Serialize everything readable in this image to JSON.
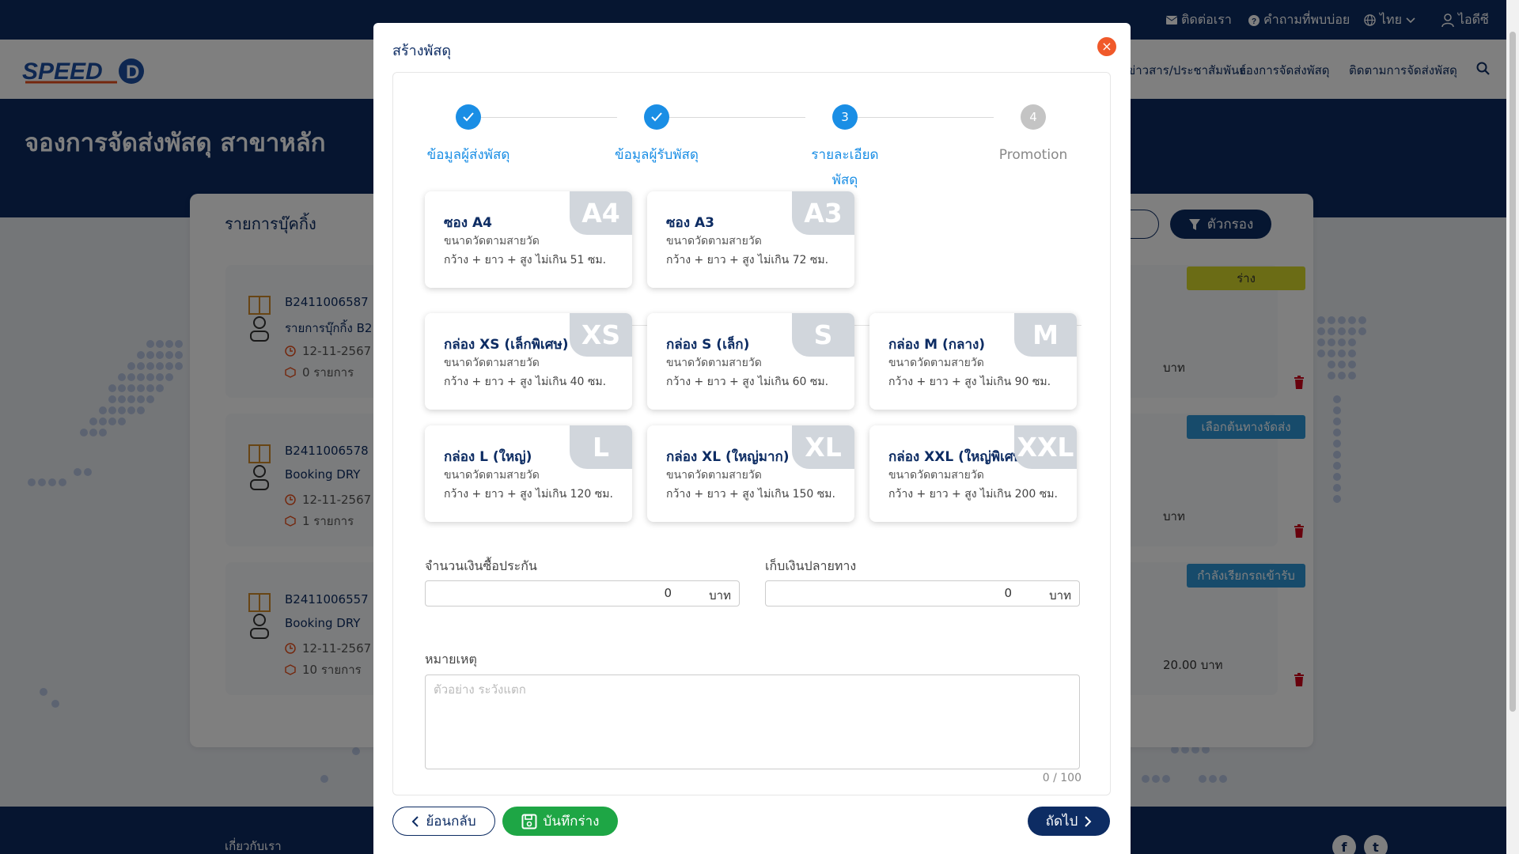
{
  "topbar": {
    "contact": "ติดต่อเรา",
    "faq": "คำถามที่พบบ่อย",
    "language": "ไทย",
    "account": "ไอดีซี"
  },
  "navbar": {
    "links": [
      "ข่าวสาร/ประชาสัมพันธ์",
      "จองการจัดส่งพัสดุ",
      "ติดตามการจัดส่งพัสดุ"
    ]
  },
  "hero": {
    "title": "จองการจัดส่งพัสดุ สาขาหลัก"
  },
  "panel": {
    "title": "รายการบุ๊คกิ้ง",
    "filter_label": "ตัวกรอง",
    "bookings": [
      {
        "id": "B2411006587",
        "name": "รายการบุ๊กกิ้ง B2",
        "date": "12-11-2567",
        "qty": "0 รายการ",
        "status": "ร่าง",
        "amount": "บาท"
      },
      {
        "id": "B2411006578",
        "name": "Booking DRY",
        "date": "12-11-2567",
        "qty": "1 รายการ",
        "status": "เลือกต้นทางจัดส่ง",
        "amount": "บาท"
      },
      {
        "id": "B2411006557",
        "name": "Booking DRY",
        "date": "12-11-2567",
        "qty": "10 รายการ",
        "status": "กำลังเรียกรถเข้ารับ",
        "amount": "20.00 บาท"
      }
    ]
  },
  "footer": {
    "about": "เกี่ยวกับเรา"
  },
  "modal": {
    "title": "สร้างพัสดุ",
    "steps": [
      {
        "label": "ข้อมูลผู้ส่งพัสดุ",
        "number": "1",
        "state": "done"
      },
      {
        "label": "ข้อมูลผู้รับพัสดุ",
        "number": "2",
        "state": "done"
      },
      {
        "label": "รายละเอียดพัสดุ",
        "number": "3",
        "state": "active"
      },
      {
        "label": "Promotion",
        "number": "4",
        "state": "pending"
      }
    ],
    "envelopes": [
      {
        "badge": "A4",
        "title": "ซอง A4",
        "sub": "ขนาดวัดตามสายวัด",
        "desc": "กว้าง + ยาว + สูง ไม่เกิน 51 ซม."
      },
      {
        "badge": "A3",
        "title": "ซอง A3",
        "sub": "ขนาดวัดตามสายวัด",
        "desc": "กว้าง + ยาว + สูง ไม่เกิน 72 ซม."
      }
    ],
    "boxes": [
      {
        "badge": "XS",
        "title": "กล่อง XS (เล็กพิเศษ)",
        "sub": "ขนาดวัดตามสายวัด",
        "desc": "กว้าง + ยาว + สูง ไม่เกิน 40 ซม."
      },
      {
        "badge": "S",
        "title": "กล่อง S (เล็ก)",
        "sub": "ขนาดวัดตามสายวัด",
        "desc": "กว้าง + ยาว + สูง ไม่เกิน 60 ซม."
      },
      {
        "badge": "M",
        "title": "กล่อง M (กลาง)",
        "sub": "ขนาดวัดตามสายวัด",
        "desc": "กว้าง + ยาว + สูง ไม่เกิน 90 ซม."
      },
      {
        "badge": "L",
        "title": "กล่อง L (ใหญ่)",
        "sub": "ขนาดวัดตามสายวัด",
        "desc": "กว้าง + ยาว + สูง ไม่เกิน 120 ซม."
      },
      {
        "badge": "XL",
        "title": "กล่อง XL (ใหญ่มาก)",
        "sub": "ขนาดวัดตามสายวัด",
        "desc": "กว้าง + ยาว + สูง ไม่เกิน 150 ซม."
      },
      {
        "badge": "XXL",
        "title": "กล่อง XXL (ใหญ่พิเศษ)",
        "sub": "ขนาดวัดตามสายวัด",
        "desc": "กว้าง + ยาว + สูง ไม่เกิน 200 ซม."
      }
    ],
    "insurance": {
      "label": "จำนวนเงินซื้อประกัน",
      "value": "0",
      "unit": "บาท"
    },
    "cod": {
      "label": "เก็บเงินปลายทาง",
      "value": "0",
      "unit": "บาท"
    },
    "remark": {
      "label": "หมายเหตุ",
      "placeholder": "ตัวอย่าง ระวังแตก",
      "count": "0 / 100"
    },
    "buttons": {
      "back": "ย้อนกลับ",
      "save": "บันทึกร่าง",
      "next": "ถัดไป"
    }
  },
  "colors": {
    "navy": "#0d2c63",
    "step_blue": "#1a8ee5",
    "save_green": "#1ea645",
    "close_orange": "#f0592a",
    "badge_grey": "#d1d6dc"
  }
}
